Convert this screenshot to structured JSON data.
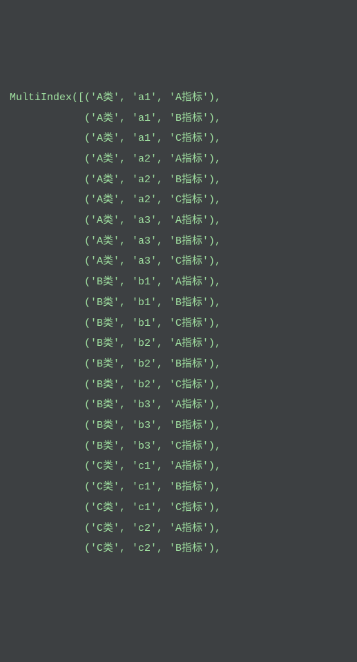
{
  "code": {
    "function_name": "MultiIndex",
    "open": "([",
    "rows": [
      [
        "'A类'",
        "'a1'",
        "'A指标'"
      ],
      [
        "'A类'",
        "'a1'",
        "'B指标'"
      ],
      [
        "'A类'",
        "'a1'",
        "'C指标'"
      ],
      [
        "'A类'",
        "'a2'",
        "'A指标'"
      ],
      [
        "'A类'",
        "'a2'",
        "'B指标'"
      ],
      [
        "'A类'",
        "'a2'",
        "'C指标'"
      ],
      [
        "'A类'",
        "'a3'",
        "'A指标'"
      ],
      [
        "'A类'",
        "'a3'",
        "'B指标'"
      ],
      [
        "'A类'",
        "'a3'",
        "'C指标'"
      ],
      [
        "'B类'",
        "'b1'",
        "'A指标'"
      ],
      [
        "'B类'",
        "'b1'",
        "'B指标'"
      ],
      [
        "'B类'",
        "'b1'",
        "'C指标'"
      ],
      [
        "'B类'",
        "'b2'",
        "'A指标'"
      ],
      [
        "'B类'",
        "'b2'",
        "'B指标'"
      ],
      [
        "'B类'",
        "'b2'",
        "'C指标'"
      ],
      [
        "'B类'",
        "'b3'",
        "'A指标'"
      ],
      [
        "'B类'",
        "'b3'",
        "'B指标'"
      ],
      [
        "'B类'",
        "'b3'",
        "'C指标'"
      ],
      [
        "'C类'",
        "'c1'",
        "'A指标'"
      ],
      [
        "'C类'",
        "'c1'",
        "'B指标'"
      ],
      [
        "'C类'",
        "'c1'",
        "'C指标'"
      ],
      [
        "'C类'",
        "'c2'",
        "'A指标'"
      ],
      [
        "'C类'",
        "'c2'",
        "'B指标'"
      ]
    ],
    "indent": "            ",
    "tuple_open": "(",
    "tuple_close": ")",
    "separator": ", ",
    "row_suffix": ","
  }
}
